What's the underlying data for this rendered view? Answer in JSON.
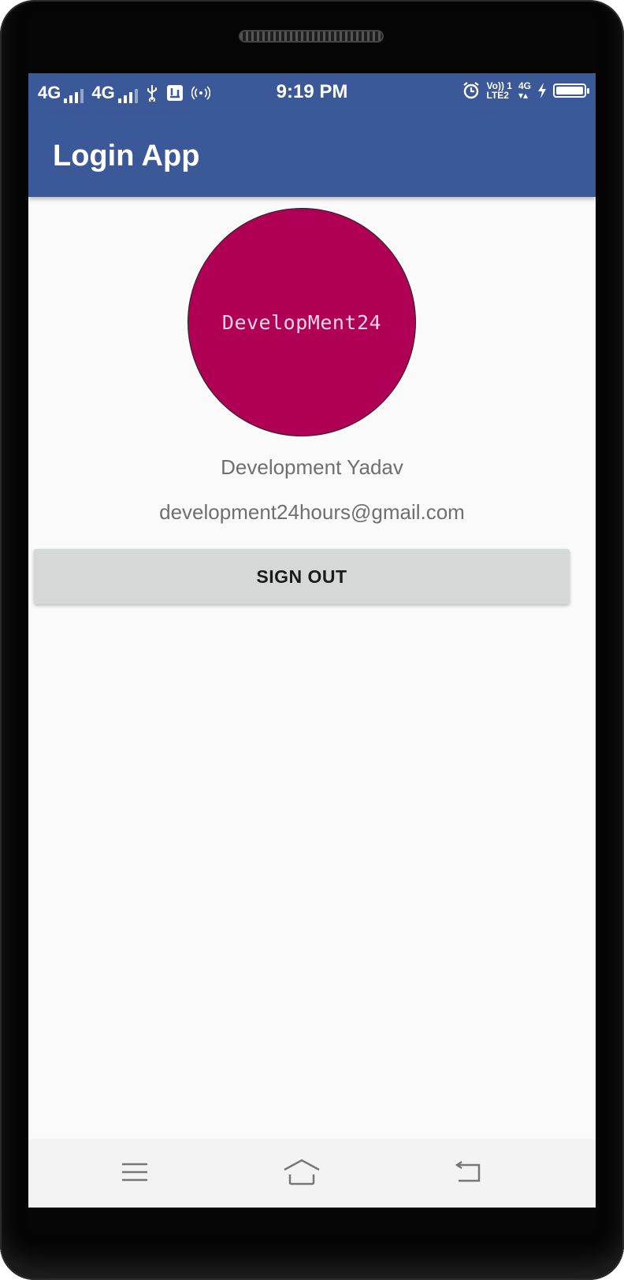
{
  "status_bar": {
    "network_1": "4G",
    "network_2": "4G",
    "time": "9:19 PM",
    "volte_label": "Vo)) 1",
    "lte_label": "LTE2",
    "data_label": "4G"
  },
  "app_bar": {
    "title": "Login App"
  },
  "profile": {
    "avatar_text": "DevelopMent24",
    "avatar_color": "#b00055",
    "name": "Development Yadav",
    "email": "development24hours@gmail.com"
  },
  "actions": {
    "sign_out_label": "SIGN OUT"
  },
  "theme": {
    "primary": "#3b5998",
    "button_bg": "#d6d7d7"
  },
  "icons": {
    "usb": "usb-icon",
    "alarm": "alarm-clock-icon",
    "charging": "lightning-icon",
    "nav_menu": "menu-icon",
    "nav_home": "home-icon",
    "nav_back": "back-icon"
  }
}
